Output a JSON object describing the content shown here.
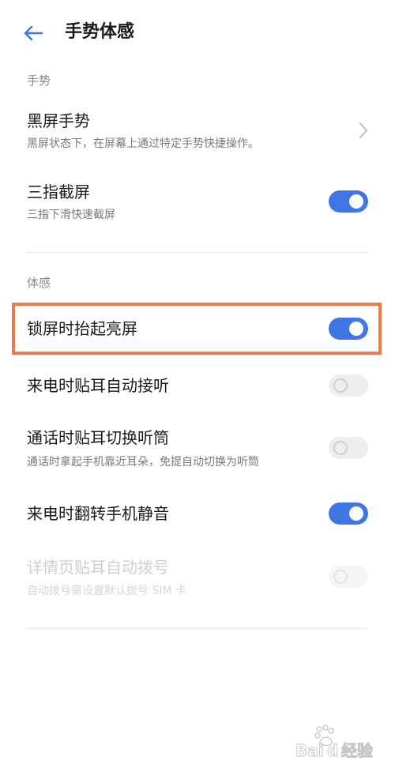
{
  "header": {
    "title": "手势体感"
  },
  "sections": {
    "gesture_label": "手势",
    "motion_label": "体感"
  },
  "rows": {
    "black_screen_gesture": {
      "title": "黑屏手势",
      "subtitle": "黑屏状态下，在屏幕上通过特定手势快捷操作。"
    },
    "three_finger_screenshot": {
      "title": "三指截屏",
      "subtitle": "三指下滑快速截屏",
      "enabled": true
    },
    "raise_to_wake": {
      "title": "锁屏时抬起亮屏",
      "enabled": true
    },
    "ear_auto_answer": {
      "title": "来电时贴耳自动接听",
      "enabled": false
    },
    "ear_switch_receiver": {
      "title": "通话时贴耳切换听筒",
      "subtitle": "通话时拿起手机靠近耳朵，免提自动切换为听筒",
      "enabled": false
    },
    "flip_to_mute": {
      "title": "来电时翻转手机静音",
      "enabled": true
    },
    "ear_auto_dial": {
      "title": "详情页贴耳自动拨号",
      "subtitle": "自动拨号需设置默认拨号 SIM 卡",
      "enabled": false,
      "disabled": true
    }
  },
  "colors": {
    "accent": "#3f76e4",
    "highlight_border": "#ec7b4a",
    "section_label": "#8a8a8a"
  },
  "icons": {
    "back": "arrow-left-icon",
    "chevron": "chevron-right-icon",
    "watermark": "baidu-jingyan-logo"
  },
  "watermark": {
    "text": "Bai 经验"
  }
}
